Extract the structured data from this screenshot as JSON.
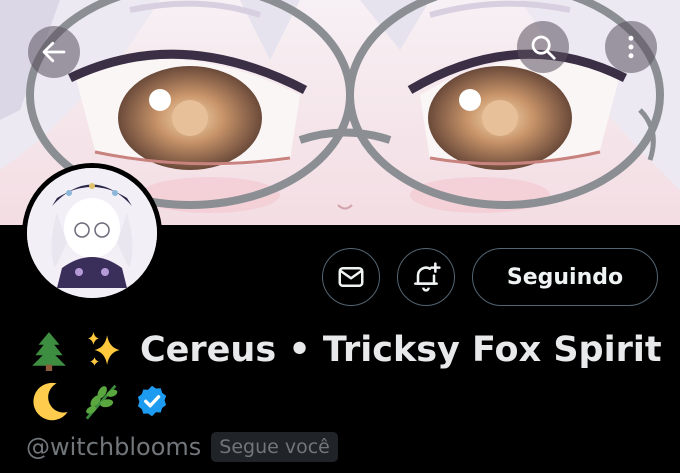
{
  "header": {
    "back_icon": "arrow-left-icon",
    "search_icon": "search-icon",
    "more_icon": "more-vertical-icon"
  },
  "actions": {
    "message_icon": "envelope-icon",
    "notify_icon": "bell-plus-icon",
    "follow_label": "Seguindo"
  },
  "profile": {
    "display_name": "Cereus • Tricksy Fox Spirit",
    "emojis_line1": [
      "evergreen-tree-emoji",
      "sparkles-emoji"
    ],
    "emojis_line2": [
      "crescent-moon-emoji",
      "herb-emoji"
    ],
    "verified_icon": "verified-badge-icon",
    "handle": "@witchblooms",
    "follows_you": "Segue você"
  },
  "colors": {
    "background": "#000000",
    "text_primary": "#e7e9ea",
    "text_secondary": "#71767b",
    "border": "#536471",
    "verified": "#1d9bf0"
  }
}
